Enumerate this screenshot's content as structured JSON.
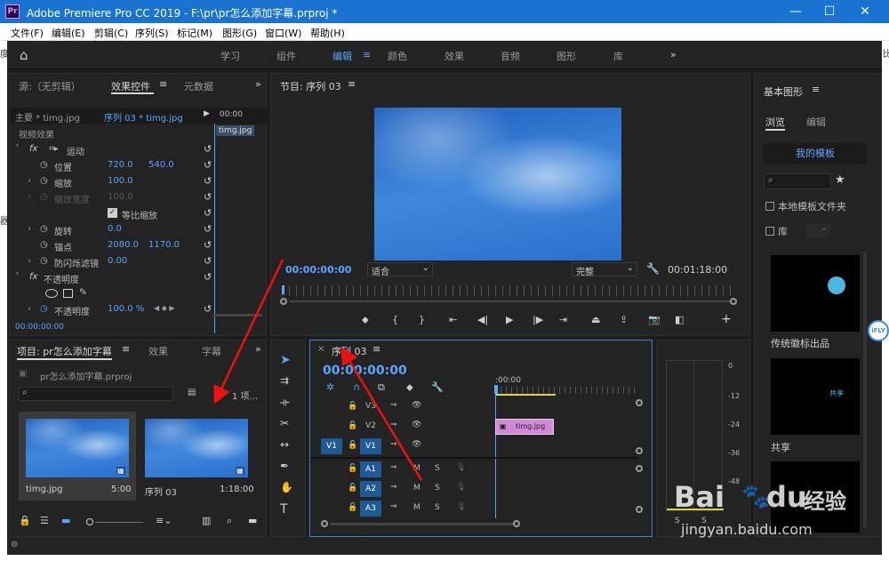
{
  "window": {
    "title": "Adobe Premiere Pro CC 2019 - F:\\pr\\pr怎么添加字幕.prproj *",
    "app_icon": "Pr",
    "minimize": "—",
    "maximize": "☐",
    "close": "✕"
  },
  "menu": [
    "文件(F)",
    "编辑(E)",
    "剪辑(C)",
    "序列(S)",
    "标记(M)",
    "图形(G)",
    "窗口(W)",
    "帮助(H)"
  ],
  "workspace": {
    "tabs": [
      "学习",
      "组件",
      "编辑",
      "颜色",
      "效果",
      "音频",
      "图形",
      "库"
    ],
    "active": "编辑",
    "more": "»"
  },
  "source_panel": {
    "tabs": [
      "源:（无剪辑）",
      "效果控件",
      "元数据"
    ],
    "active": "效果控件",
    "master": "主要 * timg.jpg",
    "sequence": "序列 03 * timg.jpg",
    "timecode_start": "00:00",
    "clip_label": "timg.jpg",
    "section": "视频效果",
    "rows": [
      {
        "indent": 1,
        "fx": "fx",
        "label": "运动",
        "v1": "",
        "v2": ""
      },
      {
        "indent": 2,
        "label": "位置",
        "v1": "720.0",
        "v2": "540.0"
      },
      {
        "indent": 2,
        "label": "缩放",
        "v1": "100.0",
        "v2": ""
      },
      {
        "indent": 2,
        "label": "缩放宽度",
        "v1": "100.0",
        "v2": "",
        "dim": true
      },
      {
        "indent": 3,
        "label": "等比缩放",
        "v1": "",
        "v2": "",
        "checkbox": true
      },
      {
        "indent": 2,
        "label": "旋转",
        "v1": "0.0",
        "v2": ""
      },
      {
        "indent": 2,
        "label": "锚点",
        "v1": "2080.0",
        "v2": "1170.0"
      },
      {
        "indent": 2,
        "label": "防闪烁滤镜",
        "v1": "0.00",
        "v2": ""
      },
      {
        "indent": 1,
        "fx": "fx",
        "label": "不透明度",
        "v1": "",
        "v2": ""
      },
      {
        "indent": 2,
        "label": "",
        "v1": "",
        "v2": "",
        "shapes": true
      },
      {
        "indent": 2,
        "label": "不透明度",
        "v1": "100.0 %",
        "v2": ""
      }
    ],
    "current_time": "00:00:00:00"
  },
  "program_panel": {
    "title": "节目: 序列 03",
    "timecode": "00:00:00:00",
    "fit": "适合",
    "quality": "完整",
    "duration": "00:01:18:00"
  },
  "project_panel": {
    "tabs": [
      "项目: pr怎么添加字幕",
      "效果",
      "字幕"
    ],
    "active": "项目: pr怎么添加字幕",
    "file": "pr怎么添加字幕.prproj",
    "count": "1 项...",
    "items": [
      {
        "name": "timg.jpg",
        "duration": "5:00"
      },
      {
        "name": "序列 03",
        "duration": "1:18:00"
      }
    ]
  },
  "timeline": {
    "tab": "序列 03",
    "timecode": "00:00:00:00",
    "ruler_start": ":00:00",
    "clip": "timg.jpg",
    "video_tracks": [
      {
        "name": "V3"
      },
      {
        "name": "V2"
      },
      {
        "name": "V1",
        "source": "V1"
      }
    ],
    "audio_tracks": [
      {
        "name": "A1"
      },
      {
        "name": "A2"
      },
      {
        "name": "A3"
      }
    ],
    "mute": "M",
    "solo": "S"
  },
  "meter": {
    "scale": [
      "0",
      "-12",
      "-24",
      "-36",
      "-48"
    ],
    "labels": [
      "S",
      "S"
    ]
  },
  "essential_graphics": {
    "title": "基本图形",
    "tabs": [
      "浏览",
      "编辑"
    ],
    "active": "浏览",
    "my_templates": "我的模板",
    "local_folder": "本地模板文件夹",
    "lib": "库",
    "templates": [
      {
        "name": "传统徽标出品"
      },
      {
        "name": "共享",
        "thumb_text": "共享"
      }
    ]
  },
  "watermark": {
    "brand": "Bai",
    "paw": "du",
    "cn": "经验",
    "url": "jingyan.baidu.com"
  },
  "side_tag": "iFLY",
  "desk_glyphs": [
    "度",
    "比",
    "器"
  ]
}
